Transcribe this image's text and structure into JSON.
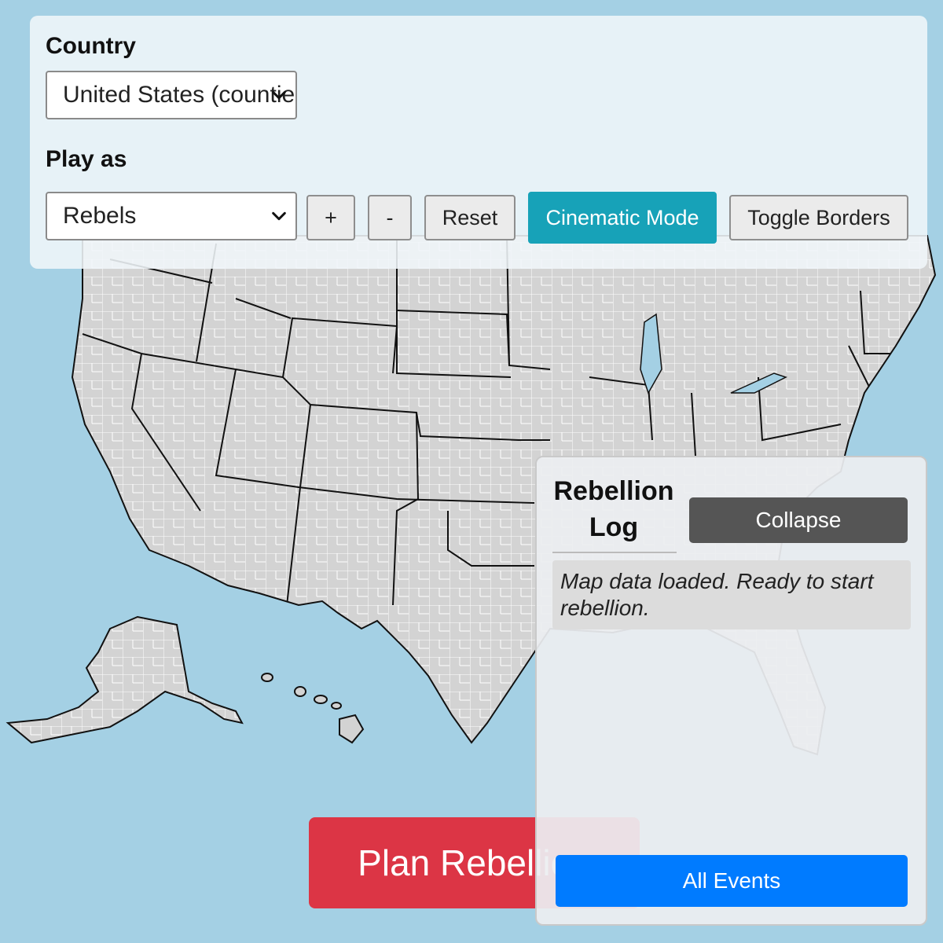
{
  "controls": {
    "country_label": "Country",
    "country_selected": "United States (counties)",
    "play_as_label": "Play as",
    "play_as_selected": "Rebels",
    "zoom_in_label": "+",
    "zoom_out_label": "-",
    "reset_label": "Reset",
    "cinematic_label": "Cinematic Mode",
    "toggle_borders_label": "Toggle Borders"
  },
  "plan_button_label": "Plan Rebellion",
  "log": {
    "title": "Rebellion Log",
    "collapse_label": "Collapse",
    "entries": [
      "Map data loaded. Ready to start rebellion."
    ],
    "all_events_label": "All Events"
  },
  "colors": {
    "ocean": "#a4d0e4",
    "land": "#d3d3d3",
    "cinematic_button": "#17a2b8",
    "plan_button": "#dc3545",
    "all_events_button": "#007bff",
    "collapse_button": "#555555"
  },
  "icons": {
    "select_arrow": "chevron-down-icon"
  }
}
